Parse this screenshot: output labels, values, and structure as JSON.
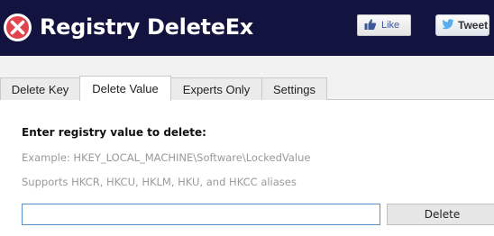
{
  "header": {
    "title": "Registry DeleteEx",
    "logo_icon": "close-circle-icon",
    "like_label": "Like",
    "tweet_label": "Tweet"
  },
  "tabs": [
    {
      "label": "Delete Key",
      "active": false
    },
    {
      "label": "Delete Value",
      "active": true
    },
    {
      "label": "Experts Only",
      "active": false
    },
    {
      "label": "Settings",
      "active": false
    }
  ],
  "main": {
    "prompt": "Enter registry value to delete:",
    "example": "Example: HKEY_LOCAL_MACHINE\\Software\\LockedValue",
    "supports": "Supports HKCR, HKCU, HKLM, HKU, and HKCC aliases",
    "input_value": "",
    "delete_label": "Delete"
  },
  "colors": {
    "header_bg": "#13133f",
    "logo_red": "#e2444d",
    "input_border": "#5b8fc7"
  }
}
